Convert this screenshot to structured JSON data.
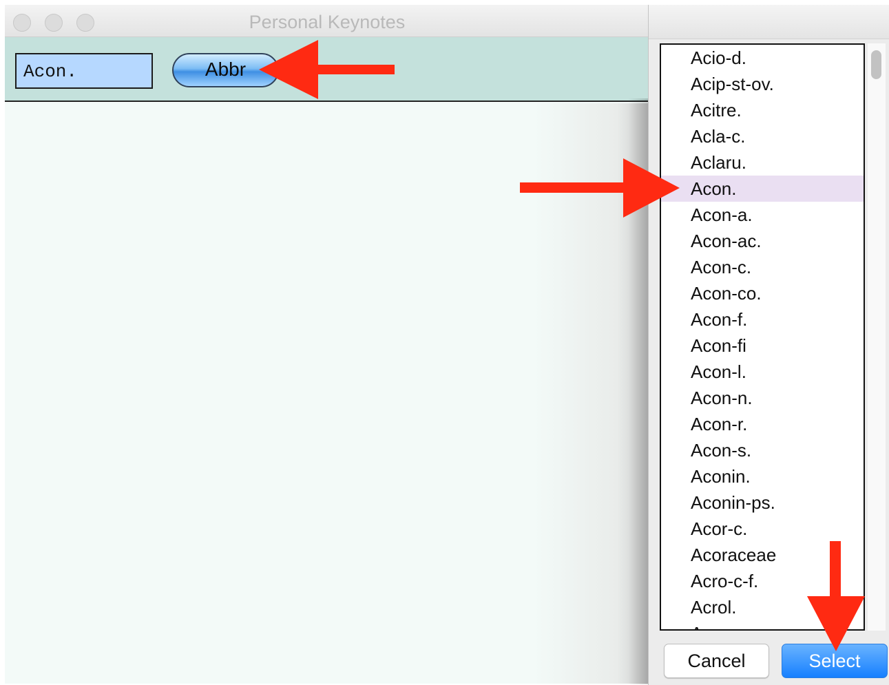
{
  "window": {
    "title": "Personal Keynotes",
    "controls": [
      "close",
      "minimize",
      "zoom"
    ]
  },
  "toolbar": {
    "abbreviation_field_value": "Acon.",
    "abbr_button_label": "Abbr"
  },
  "list": {
    "items": [
      "Acio-d.",
      "Acip-st-ov.",
      "Acitre.",
      "Acla-c.",
      "Aclaru.",
      "Acon.",
      "Acon-a.",
      "Acon-ac.",
      "Acon-c.",
      "Acon-co.",
      "Acon-f.",
      "Acon-fi",
      "Acon-l.",
      "Acon-n.",
      "Acon-r.",
      "Acon-s.",
      "Aconin.",
      "Aconin-ps.",
      "Acor-c.",
      "Acoraceae",
      "Acro-c-f.",
      "Acrol.",
      "Acrom-e."
    ],
    "selected_item": "Acon."
  },
  "dialog_buttons": {
    "cancel_label": "Cancel",
    "select_label": "Select"
  },
  "colors": {
    "toolbar_bg": "#c4e1dc",
    "field_bg": "#b6d8ff",
    "selected_row_bg": "#eadff2",
    "select_button": "#1780ff",
    "annotation_arrow": "#ff2a12"
  }
}
